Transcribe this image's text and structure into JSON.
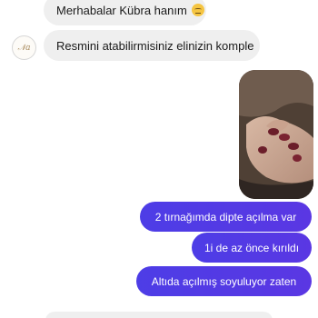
{
  "conversation": {
    "incoming": {
      "greeting": "Merhabalar Kübra hanım",
      "greeting_emoji": "relieved-face-emoji",
      "request": "Resmini atabilirmisiniz elinizin komple",
      "avatar_icon": "Na-logo-avatar"
    },
    "outgoing": {
      "line1": "2 tırnağımda dipte açılma var",
      "line2": "1i de az önce kırıldı",
      "line3": "Altıda açılmış soyuluyor zaten"
    },
    "photo_attachment": "hand-nails-photo"
  },
  "colors": {
    "incoming_bubble": "#efefef",
    "outgoing_bubble": "#4d3de6",
    "text_dark": "#1a1a1a",
    "text_light": "#ffffff"
  }
}
